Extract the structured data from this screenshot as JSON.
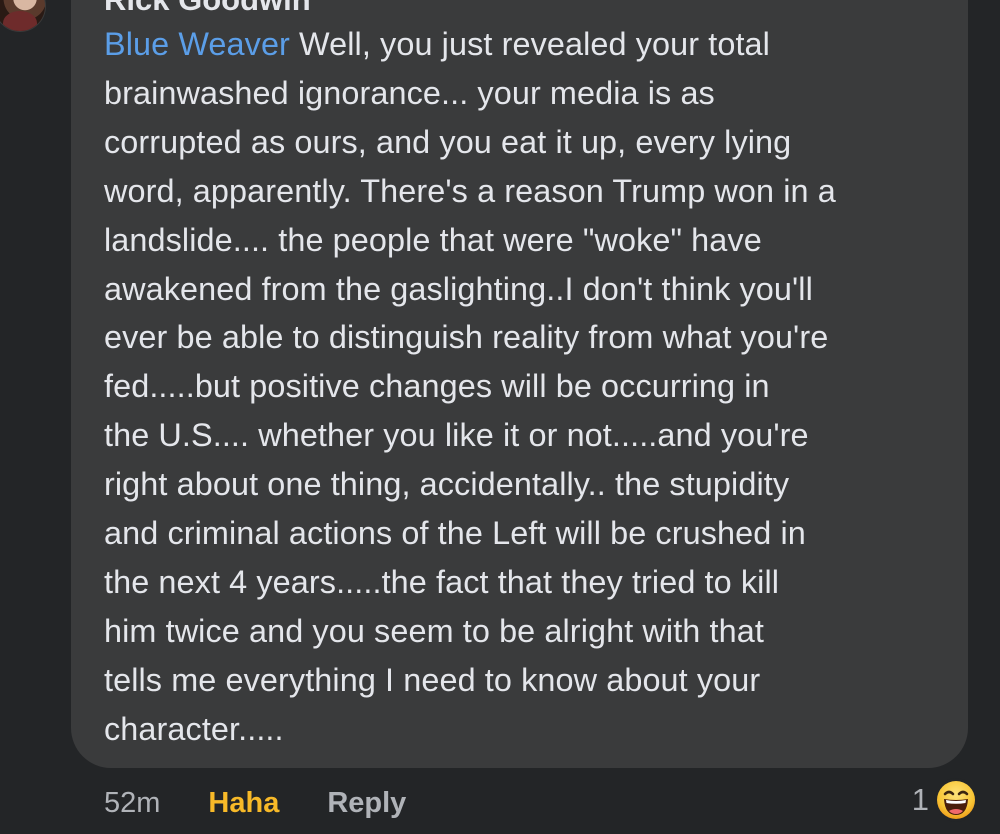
{
  "comment": {
    "author": "Rick Goodwin",
    "mention": "Blue Weaver",
    "lines": [
      " Well, you just revealed your total",
      "brainwashed ignorance... your media is as",
      "corrupted as ours, and you eat it up, every lying",
      "word, apparently. There's a reason Trump won in a",
      "landslide....  the people that were \"woke\" have",
      "awakened from the gaslighting..I don't think you'll",
      "ever be able to distinguish reality from what you're",
      "fed.....but positive changes will be  occurring in",
      "the U.S.... whether you like it or not.....and you're",
      "right about  one thing, accidentally.. the stupidity",
      "and criminal actions of the Left will be crushed in",
      "the next 4 years.....the fact that they tried to kill",
      "him twice and you seem to be alright with that",
      "tells me everything I need to know about your",
      "character....."
    ]
  },
  "actions": {
    "timestamp": "52m",
    "reaction_label": "Haha",
    "reply_label": "Reply"
  },
  "reactions": {
    "count": "1",
    "icon": "haha-emoji-icon"
  },
  "colors": {
    "background": "#232527",
    "bubble": "#3a3b3c",
    "text": "#e4e6eb",
    "mention": "#5b9ee8",
    "haha": "#f7b928",
    "muted": "#b0b3b8"
  }
}
